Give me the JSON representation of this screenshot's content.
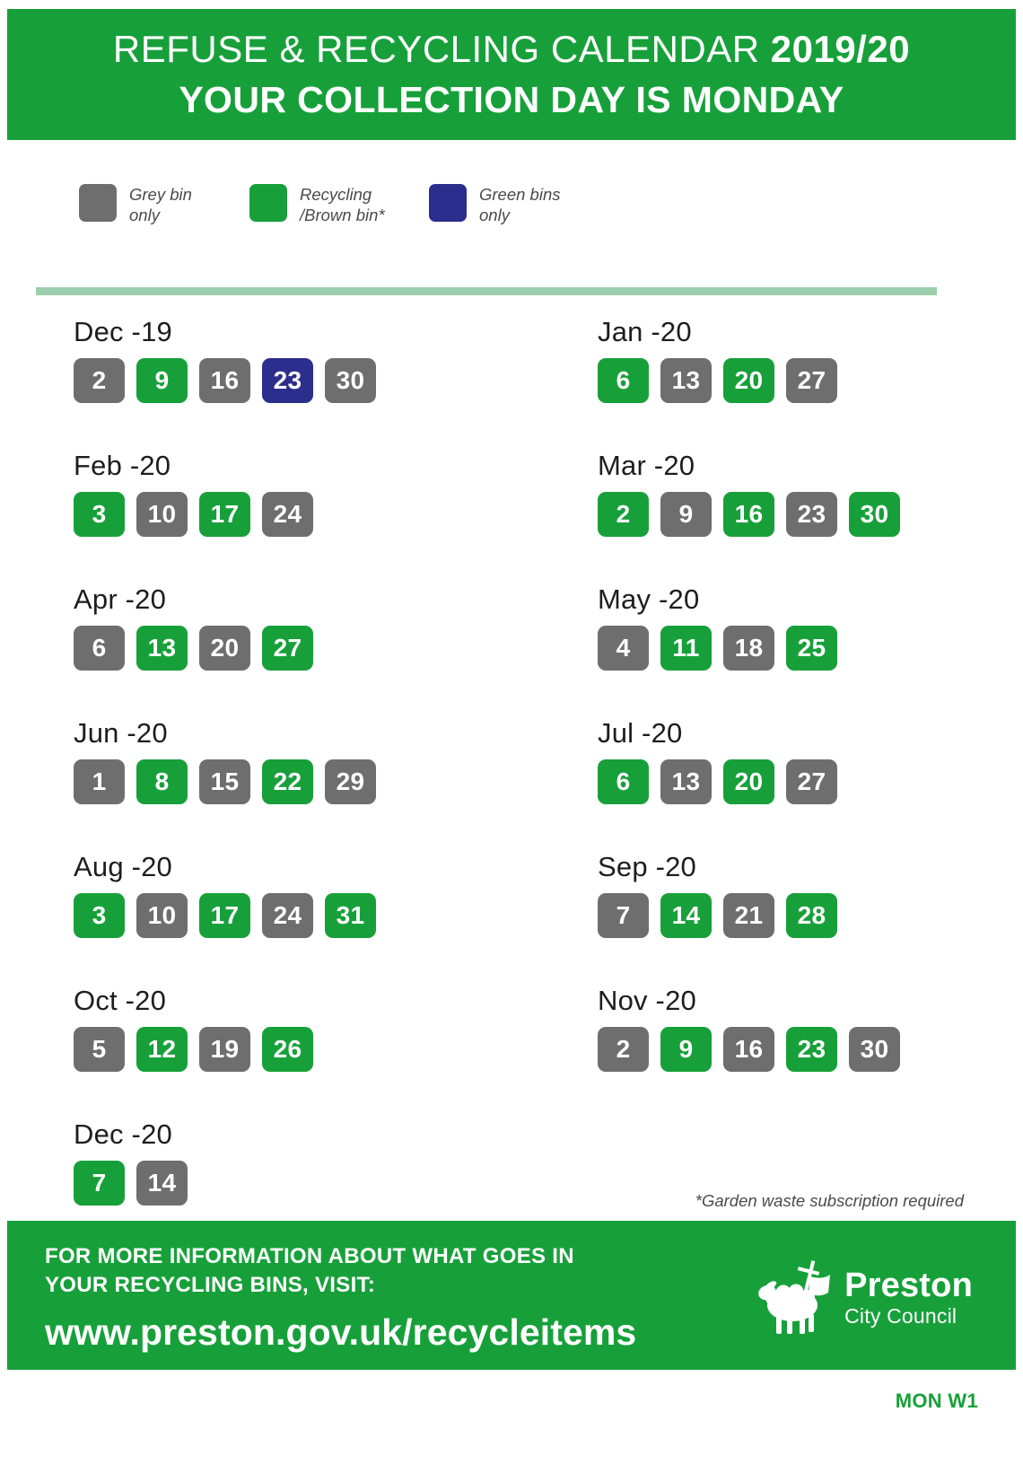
{
  "header": {
    "title_main": "REFUSE & RECYCLING CALENDAR",
    "title_year": "2019/20",
    "subtitle": "YOUR COLLECTION DAY IS MONDAY"
  },
  "legend": {
    "items": [
      {
        "label": "Grey bin\nonly",
        "color": "#6e6e6e",
        "key": "grey"
      },
      {
        "label": "Recycling\n/Brown bin*",
        "color": "#17a03a",
        "key": "green"
      },
      {
        "label": "Green bins\nonly",
        "color": "#2b2e8c",
        "key": "blue"
      }
    ]
  },
  "calendar": {
    "months": [
      {
        "name": "Dec -19",
        "days": [
          {
            "n": "2",
            "type": "grey"
          },
          {
            "n": "9",
            "type": "green"
          },
          {
            "n": "16",
            "type": "grey"
          },
          {
            "n": "23",
            "type": "blue"
          },
          {
            "n": "30",
            "type": "grey"
          }
        ]
      },
      {
        "name": "Jan -20",
        "days": [
          {
            "n": "6",
            "type": "green"
          },
          {
            "n": "13",
            "type": "grey"
          },
          {
            "n": "20",
            "type": "green"
          },
          {
            "n": "27",
            "type": "grey"
          }
        ]
      },
      {
        "name": "Feb -20",
        "days": [
          {
            "n": "3",
            "type": "green"
          },
          {
            "n": "10",
            "type": "grey"
          },
          {
            "n": "17",
            "type": "green"
          },
          {
            "n": "24",
            "type": "grey"
          }
        ]
      },
      {
        "name": "Mar -20",
        "days": [
          {
            "n": "2",
            "type": "green"
          },
          {
            "n": "9",
            "type": "grey"
          },
          {
            "n": "16",
            "type": "green"
          },
          {
            "n": "23",
            "type": "grey"
          },
          {
            "n": "30",
            "type": "green"
          }
        ]
      },
      {
        "name": "Apr -20",
        "days": [
          {
            "n": "6",
            "type": "grey"
          },
          {
            "n": "13",
            "type": "green"
          },
          {
            "n": "20",
            "type": "grey"
          },
          {
            "n": "27",
            "type": "green"
          }
        ]
      },
      {
        "name": "May -20",
        "days": [
          {
            "n": "4",
            "type": "grey"
          },
          {
            "n": "11",
            "type": "green"
          },
          {
            "n": "18",
            "type": "grey"
          },
          {
            "n": "25",
            "type": "green"
          }
        ]
      },
      {
        "name": "Jun -20",
        "days": [
          {
            "n": "1",
            "type": "grey"
          },
          {
            "n": "8",
            "type": "green"
          },
          {
            "n": "15",
            "type": "grey"
          },
          {
            "n": "22",
            "type": "green"
          },
          {
            "n": "29",
            "type": "grey"
          }
        ]
      },
      {
        "name": "Jul -20",
        "days": [
          {
            "n": "6",
            "type": "green"
          },
          {
            "n": "13",
            "type": "grey"
          },
          {
            "n": "20",
            "type": "green"
          },
          {
            "n": "27",
            "type": "grey"
          }
        ]
      },
      {
        "name": "Aug -20",
        "days": [
          {
            "n": "3",
            "type": "green"
          },
          {
            "n": "10",
            "type": "grey"
          },
          {
            "n": "17",
            "type": "green"
          },
          {
            "n": "24",
            "type": "grey"
          },
          {
            "n": "31",
            "type": "green"
          }
        ]
      },
      {
        "name": "Sep -20",
        "days": [
          {
            "n": "7",
            "type": "grey"
          },
          {
            "n": "14",
            "type": "green"
          },
          {
            "n": "21",
            "type": "grey"
          },
          {
            "n": "28",
            "type": "green"
          }
        ]
      },
      {
        "name": "Oct -20",
        "days": [
          {
            "n": "5",
            "type": "grey"
          },
          {
            "n": "12",
            "type": "green"
          },
          {
            "n": "19",
            "type": "grey"
          },
          {
            "n": "26",
            "type": "green"
          }
        ]
      },
      {
        "name": "Nov -20",
        "days": [
          {
            "n": "2",
            "type": "grey"
          },
          {
            "n": "9",
            "type": "green"
          },
          {
            "n": "16",
            "type": "grey"
          },
          {
            "n": "23",
            "type": "green"
          },
          {
            "n": "30",
            "type": "grey"
          }
        ]
      },
      {
        "name": "Dec -20",
        "days": [
          {
            "n": "7",
            "type": "green"
          },
          {
            "n": "14",
            "type": "grey"
          }
        ]
      }
    ]
  },
  "footnote": "*Garden waste subscription required",
  "footer": {
    "line1": "FOR MORE INFORMATION ABOUT WHAT GOES IN",
    "line2": "YOUR RECYCLING BINS, VISIT:",
    "url": "www.preston.gov.uk/recycleitems",
    "logo_name": "Preston",
    "logo_sub": "City Council"
  },
  "round_code": "MON W1",
  "colors": {
    "brand_green": "#17a03a",
    "grey_bin": "#6e6e6e",
    "green_bin": "#2b2e8c",
    "divider": "#9bcfab"
  }
}
